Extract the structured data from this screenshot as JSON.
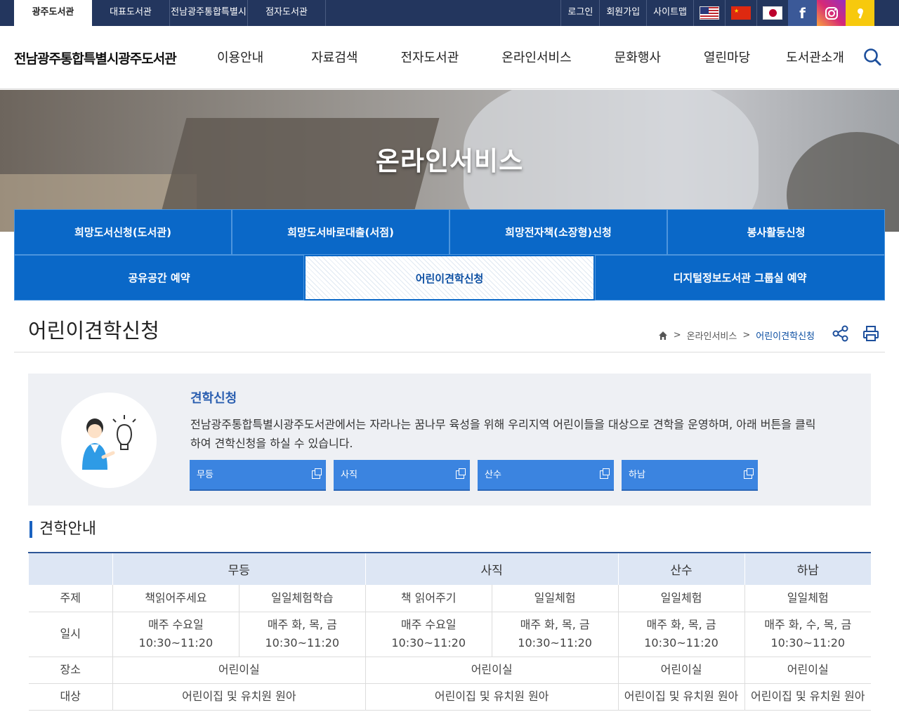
{
  "topbar": {
    "tabs": [
      {
        "label": "광주도서관",
        "active": true
      },
      {
        "label": "대표도서관"
      },
      {
        "label": "전남광주통합특별시"
      },
      {
        "label": "점자도서관"
      }
    ],
    "links": [
      "로그인",
      "회원가입",
      "사이트맵"
    ],
    "flags": [
      "us-flag-icon",
      "china-flag-icon",
      "japan-flag-icon"
    ],
    "sns": [
      {
        "icon": "facebook-icon",
        "color": "#3b5998",
        "glyph": "f"
      },
      {
        "icon": "instagram-icon",
        "color": "#c13584",
        "glyph": "◎"
      },
      {
        "icon": "kakao-icon",
        "color": "#f7c90d",
        "glyph": "❜"
      }
    ]
  },
  "header": {
    "logo": "전남광주통합특별시광주도서관",
    "gnb": [
      "이용안내",
      "자료검색",
      "전자도서관",
      "온라인서비스",
      "문화행사",
      "열린마당",
      "도서관소개"
    ]
  },
  "hero": {
    "title": "온라인서비스"
  },
  "submenu": {
    "row1": [
      "희망도서신청(도서관)",
      "희망도서바로대출(서점)",
      "희망전자책(소장형)신청",
      "봉사활동신청"
    ],
    "row2": [
      "공유공간 예약",
      "어린이견학신청",
      "디지털정보도서관 그룹실 예약"
    ],
    "active": "어린이견학신청"
  },
  "page": {
    "title": "어린이견학신청",
    "breadcrumb": [
      "온라인서비스",
      "어린이견학신청"
    ],
    "separator": ">"
  },
  "intro": {
    "heading": "견학신청",
    "text": "전남광주통합특별시광주도서관에서는 자라나는 꿈나무 육성을 위해 우리지역 어린이들을 대상으로 견학을 운영하며, 아래 버튼을 클릭하여 견학신청을 하실 수 있습니다.",
    "buttons": [
      "무등",
      "사직",
      "산수",
      "하남"
    ]
  },
  "guide": {
    "heading": "견학안내",
    "headers": [
      "무등",
      "사직",
      "산수",
      "하남"
    ],
    "rows": {
      "topic": {
        "label": "주제",
        "values": [
          "책읽어주세요",
          "일일체험학습",
          "책 읽어주기",
          "일일체험",
          "일일체험",
          "일일체험"
        ]
      },
      "time": {
        "label": "일시",
        "values": [
          [
            "매주 수요일",
            "10:30~11:20"
          ],
          [
            "매주 화, 목, 금",
            "10:30~11:20"
          ],
          [
            "매주 수요일",
            "10:30~11:20"
          ],
          [
            "매주 화, 목, 금",
            "10:30~11:20"
          ],
          [
            "매주 화, 목, 금",
            "10:30~11:20"
          ],
          [
            "매주 화, 수, 목, 금",
            "10:30~11:20"
          ]
        ]
      },
      "place": {
        "label": "장소",
        "values": [
          "어린이실",
          "어린이실",
          "어린이실",
          "어린이실"
        ]
      },
      "target": {
        "label": "대상",
        "values": [
          "어린이집 및 유치원 원아",
          "어린이집 및 유치원 원아",
          "어린이집 및 유치원 원아",
          "어린이집 및 유치원 원아"
        ]
      }
    }
  }
}
